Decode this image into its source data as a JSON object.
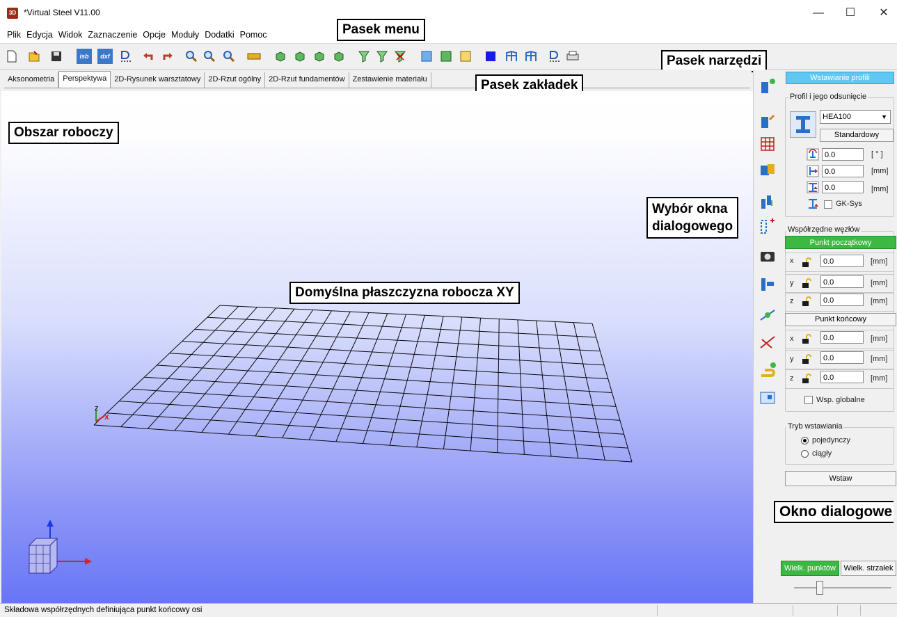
{
  "window": {
    "icon_text": "3D",
    "title": "*Virtual Steel V11.00",
    "minimize": "—",
    "maximize": "☐",
    "close": "✕"
  },
  "menu": [
    "Plik",
    "Edycja",
    "Widok",
    "Zaznaczenie",
    "Opcje",
    "Moduły",
    "Dodatki",
    "Pomoc"
  ],
  "toolbar": {
    "isb_label": "isb",
    "dxf_label": "dxf"
  },
  "annotations": {
    "menu": "Pasek menu",
    "toolbar": "Pasek narzędzi",
    "tabs": "Pasek zakładek",
    "workspace": "Obszar roboczy",
    "dialog_select_line1": "Wybór okna",
    "dialog_select_line2": "dialogowego",
    "plane": "Domyślna płaszczyzna robocza XY",
    "dialog": "Okno dialogowe"
  },
  "tabs": [
    "Aksonometria",
    "Perspektywa",
    "2D-Rysunek warsztatowy",
    "2D-Rzut ogólny",
    "2D-Rzut fundamentów",
    "Zestawienie materiału"
  ],
  "active_tab": "Perspektywa",
  "axis_labels": {
    "x": "x",
    "z": "z"
  },
  "panel": {
    "header": "Wstawianie profili",
    "profile_group": "Profil i jego odsunięcie",
    "profile_value": "HEA100",
    "standard_button": "Standardowy",
    "rotation_value": "0.0",
    "rotation_unit": "[ ° ]",
    "offset1_value": "0.0",
    "offset1_unit": "[mm]",
    "offset2_value": "0.0",
    "offset2_unit": "[mm]",
    "gk_sys": "GK-Sys",
    "coords_group": "Współrzędne węzłów",
    "start_point": "Punkt początkowy",
    "end_point": "Punkt końcowy",
    "x_label": "x",
    "y_label": "y",
    "z_label": "z",
    "start": {
      "x": "0.0",
      "y": "0.0",
      "z": "0.0"
    },
    "end": {
      "x": "0.0",
      "y": "0.0",
      "z": "0.0"
    },
    "unit": "[mm]",
    "global_coords": "Wsp. globalne",
    "mode_group": "Tryb wstawiania",
    "mode_single": "pojedynczy",
    "mode_continuous": "ciągły",
    "insert_button": "Wstaw",
    "point_size_button": "Wielk. punktów",
    "arrow_size_button": "Wielk. strzałek",
    "colors": {
      "header": "#5fc8f2",
      "green": "#3cb843"
    }
  },
  "statusbar": {
    "text": "Składowa współrzędnych definiująca punkt końcowy osi"
  }
}
